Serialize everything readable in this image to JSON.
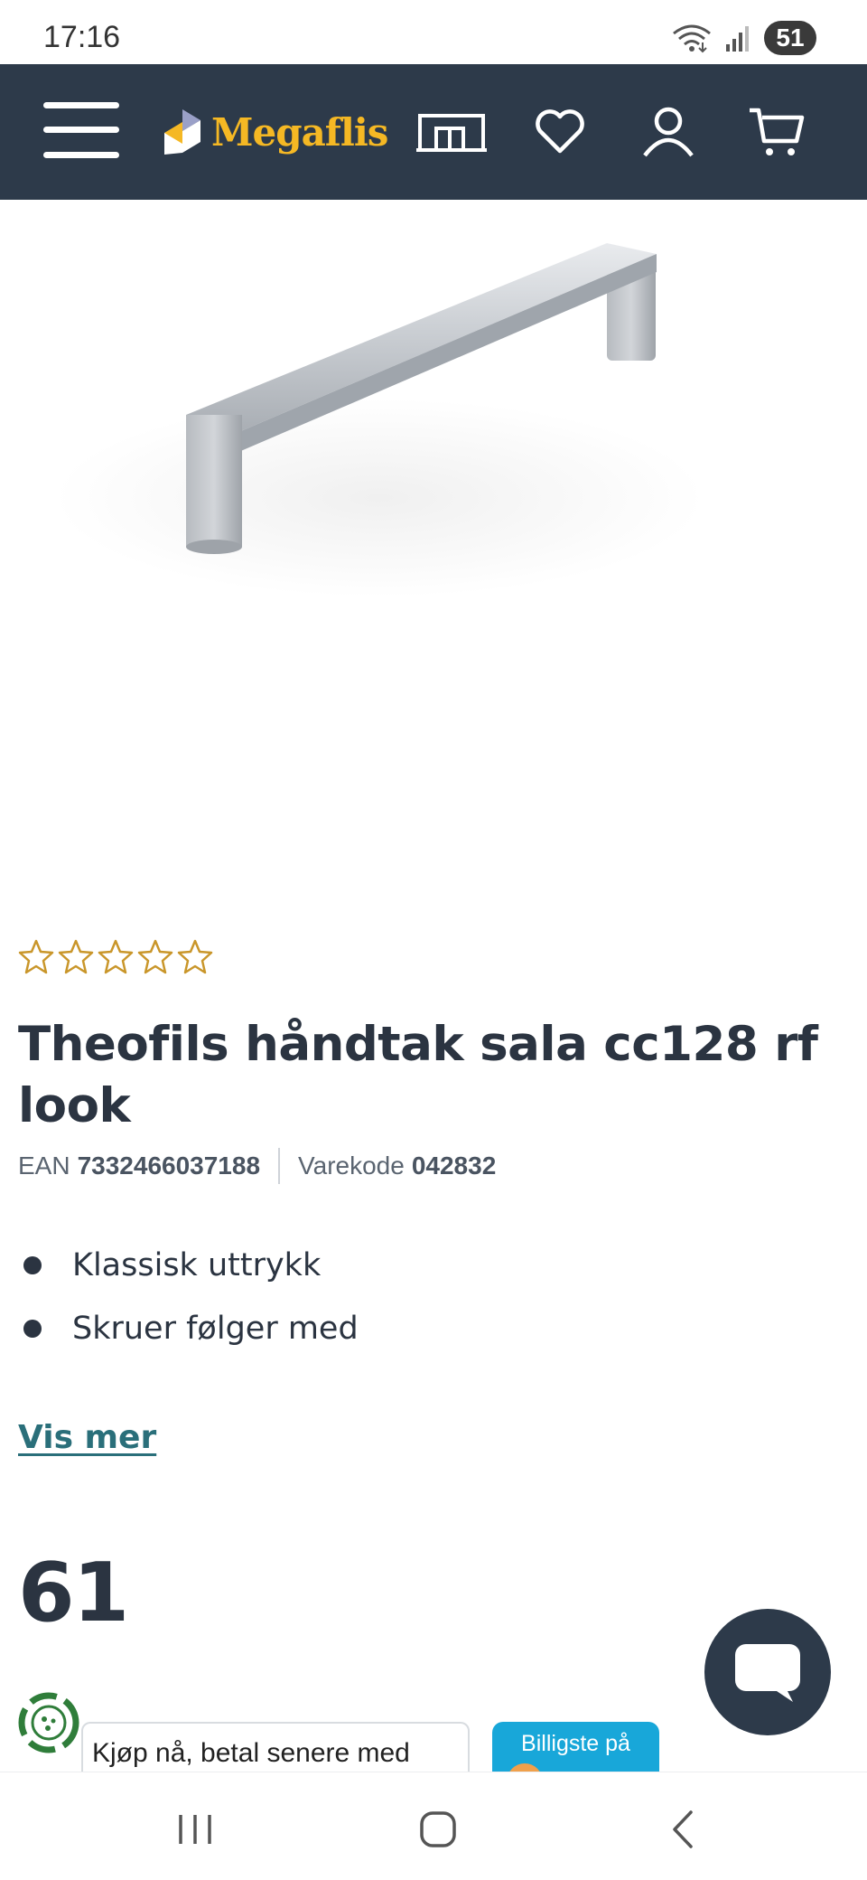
{
  "status_bar": {
    "time": "17:16",
    "battery": "51"
  },
  "header": {
    "logo_text": "Megaflis",
    "icons": [
      "menu-icon",
      "store-icon",
      "heart-icon",
      "user-icon",
      "cart-icon"
    ],
    "background_color": "#2d3a4a",
    "accent_color": "#f5b824"
  },
  "product": {
    "image_alt": "metal handle",
    "rating_stars": 0,
    "rating_max": 5,
    "title": "Theofils håndtak sala cc128 rf look",
    "ean_label": "EAN",
    "ean_value": "7332466037188",
    "varekode_label": "Varekode",
    "varekode_value": "042832",
    "features": [
      "Klassisk uttrykk",
      "Skruer følger med"
    ],
    "show_more": "Vis mer",
    "price": "61"
  },
  "payment": {
    "klarna_text": "Kjøp nå, betal senere med",
    "prisjakt_text": "Billigste på"
  },
  "nav_bar": {
    "buttons": [
      "recent-apps",
      "home",
      "back"
    ]
  }
}
